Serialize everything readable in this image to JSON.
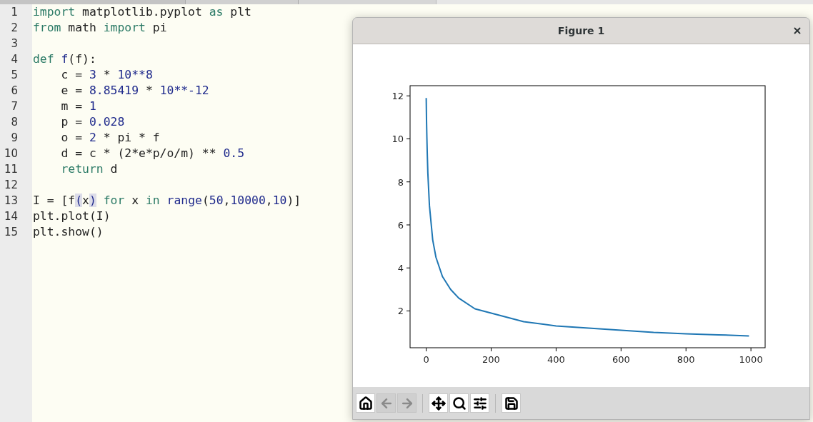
{
  "editor": {
    "lines": [
      {
        "number": "1",
        "tokens": [
          {
            "text": "import",
            "kind": "keyword"
          },
          {
            "text": " matplotlib.pyplot ",
            "kind": "plain"
          },
          {
            "text": "as",
            "kind": "keyword"
          },
          {
            "text": " plt",
            "kind": "plain"
          }
        ]
      },
      {
        "number": "2",
        "tokens": [
          {
            "text": "from",
            "kind": "keyword"
          },
          {
            "text": " math ",
            "kind": "plain"
          },
          {
            "text": "import",
            "kind": "keyword"
          },
          {
            "text": " pi",
            "kind": "plain"
          }
        ]
      },
      {
        "number": "3"
      },
      {
        "number": "4",
        "tokens": [
          {
            "text": "def",
            "kind": "keyword"
          },
          {
            "text": " f",
            "kind": "name"
          },
          {
            "text": "(f):",
            "kind": "plain"
          }
        ]
      },
      {
        "number": "5",
        "tokens": [
          {
            "text": "    c = ",
            "kind": "plain"
          },
          {
            "text": "3",
            "kind": "number"
          },
          {
            "text": " * ",
            "kind": "plain"
          },
          {
            "text": "10**8",
            "kind": "number"
          }
        ]
      },
      {
        "number": "6",
        "tokens": [
          {
            "text": "    e = ",
            "kind": "plain"
          },
          {
            "text": "8.85419",
            "kind": "number"
          },
          {
            "text": " * ",
            "kind": "plain"
          },
          {
            "text": "10**-12",
            "kind": "number"
          }
        ]
      },
      {
        "number": "7",
        "tokens": [
          {
            "text": "    m = ",
            "kind": "plain"
          },
          {
            "text": "1",
            "kind": "number"
          }
        ]
      },
      {
        "number": "8",
        "tokens": [
          {
            "text": "    p = ",
            "kind": "plain"
          },
          {
            "text": "0.028",
            "kind": "number"
          }
        ]
      },
      {
        "number": "9",
        "tokens": [
          {
            "text": "    o = ",
            "kind": "plain"
          },
          {
            "text": "2",
            "kind": "number"
          },
          {
            "text": " * pi * f",
            "kind": "plain"
          }
        ]
      },
      {
        "number": "10",
        "tokens": [
          {
            "text": "    d = c * (2*e*p/o/m) ** ",
            "kind": "plain"
          },
          {
            "text": "0.5",
            "kind": "number"
          }
        ]
      },
      {
        "number": "11",
        "tokens": [
          {
            "text": "    return",
            "kind": "keyword"
          },
          {
            "text": " d",
            "kind": "plain"
          }
        ]
      },
      {
        "number": "12"
      },
      {
        "number": "13",
        "tokens": [
          {
            "text": "I = [f",
            "kind": "plain"
          },
          {
            "text": "(",
            "kind": "bracket"
          },
          {
            "text": "x",
            "kind": "plain"
          },
          {
            "text": ")",
            "kind": "bracket"
          },
          {
            "text": " for",
            "kind": "keyword"
          },
          {
            "text": " x ",
            "kind": "plain"
          },
          {
            "text": "in",
            "kind": "keyword"
          },
          {
            "text": " range",
            "kind": "name"
          },
          {
            "text": "(",
            "kind": "plain"
          },
          {
            "text": "50",
            "kind": "number"
          },
          {
            "text": ",",
            "kind": "plain"
          },
          {
            "text": "10000",
            "kind": "number"
          },
          {
            "text": ",",
            "kind": "plain"
          },
          {
            "text": "10",
            "kind": "number"
          },
          {
            "text": ")]",
            "kind": "plain"
          }
        ]
      },
      {
        "number": "14",
        "tokens": [
          {
            "text": "plt.plot(I)",
            "kind": "plain"
          }
        ]
      },
      {
        "number": "15",
        "tokens": [
          {
            "text": "plt.show()",
            "kind": "plain"
          }
        ]
      }
    ]
  },
  "figure_window": {
    "title": "Figure 1",
    "chart_data": {
      "type": "line",
      "x": [
        0,
        1,
        2,
        3,
        5,
        10,
        20,
        30,
        50,
        75,
        100,
        150,
        200,
        300,
        400,
        500,
        600,
        700,
        800,
        900,
        994
      ],
      "series": [
        {
          "color": "#1f77b4",
          "values": [
            11.9,
            10.9,
            10.1,
            9.4,
            8.4,
            6.9,
            5.3,
            4.5,
            3.6,
            3.0,
            2.6,
            2.1,
            1.9,
            1.5,
            1.3,
            1.2,
            1.1,
            1.0,
            0.94,
            0.89,
            0.84
          ]
        }
      ],
      "xlim": [
        -49.7,
        1043.7
      ],
      "ylim": [
        0.289,
        12.473
      ],
      "xticks": [
        0,
        200,
        400,
        600,
        800,
        1000
      ],
      "yticks": [
        2,
        4,
        6,
        8,
        10,
        12
      ]
    },
    "toolbar": [
      {
        "kind": "home",
        "disabled": false
      },
      {
        "kind": "back",
        "disabled": true
      },
      {
        "kind": "forward",
        "disabled": true
      },
      {
        "kind": "separator"
      },
      {
        "kind": "pan",
        "disabled": false
      },
      {
        "kind": "zoom",
        "disabled": false
      },
      {
        "kind": "configure",
        "disabled": false
      },
      {
        "kind": "separator"
      },
      {
        "kind": "save",
        "disabled": false
      }
    ]
  }
}
